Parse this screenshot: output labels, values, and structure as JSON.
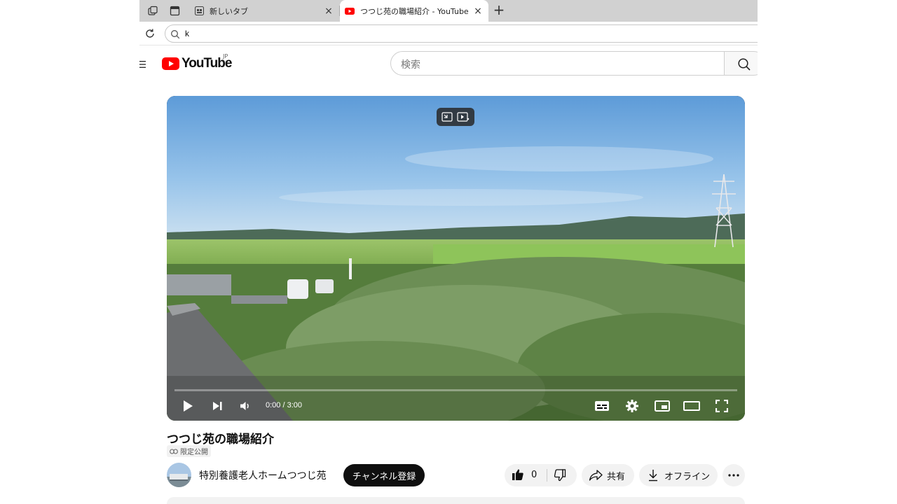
{
  "browser": {
    "tabs": [
      {
        "title": "新しいタブ",
        "close": "×"
      },
      {
        "title": "つつじ苑の職場紹介 - YouTube",
        "close": "×"
      }
    ],
    "new_tab": "+",
    "address": "k"
  },
  "youtube": {
    "logo_text": "YouTube",
    "region": "JP",
    "search_placeholder": "検索"
  },
  "player": {
    "time": "0:00 / 3:00",
    "progress": 0
  },
  "video": {
    "title": "つつじ苑の職場紹介",
    "privacy": "限定公開",
    "channel": "特別養護老人ホームつつじ苑",
    "subscribe": "チャンネル登録",
    "likes": "0",
    "share": "共有",
    "download": "オフライン",
    "more": "…"
  },
  "colors": {
    "brand_red": "#ff0000",
    "tab_strip": "#d1d1d1",
    "pill_bg": "#f2f2f2",
    "subscribe_bg": "#0f0f0f"
  }
}
